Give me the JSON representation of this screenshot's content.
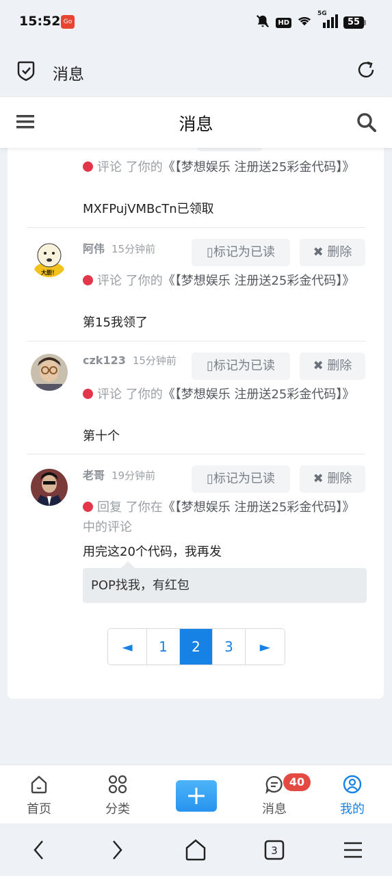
{
  "status_bar": {
    "time": "15:52",
    "app_badge": "Go",
    "hd": "HD",
    "network": "5G",
    "battery": "55"
  },
  "browser": {
    "title": "消息"
  },
  "header": {
    "title": "消息"
  },
  "messages": [
    {
      "user": "",
      "time": "",
      "action": "评论",
      "action_suffix": "了你的",
      "link": "《【梦想娱乐 注册送25彩金代码】》",
      "content": "MXFPujVMBcTn已领取"
    },
    {
      "user": "阿伟",
      "time": "15分钟前",
      "action": "评论",
      "action_suffix": "了你的",
      "link": "《【梦想娱乐 注册送25彩金代码】》",
      "content": "第15我领了",
      "avatar_caption": "大胆！"
    },
    {
      "user": "czk123",
      "time": "15分钟前",
      "action": "评论",
      "action_suffix": "了你的",
      "link": "《【梦想娱乐 注册送25彩金代码】》",
      "content": "第十个"
    },
    {
      "user": "老哥",
      "time": "19分钟前",
      "action": "回复",
      "action_suffix": "了你在",
      "link": "《【梦想娱乐 注册送25彩金代码】》",
      "link_suffix": "中的评论",
      "content": "用完这20个代码，我再发",
      "quote": "POP找我，有红包"
    }
  ],
  "buttons": {
    "mark_read": "标记为已读",
    "delete": "删除"
  },
  "pagination": {
    "prev": "◄",
    "pages": [
      "1",
      "2",
      "3"
    ],
    "current": "2",
    "next": "►"
  },
  "bottom_nav": {
    "home": "首页",
    "category": "分类",
    "messages": "消息",
    "messages_badge": "40",
    "me": "我的"
  },
  "colors": {
    "accent": "#1782e6",
    "badge": "#e54a42",
    "dot": "#e2364a"
  }
}
